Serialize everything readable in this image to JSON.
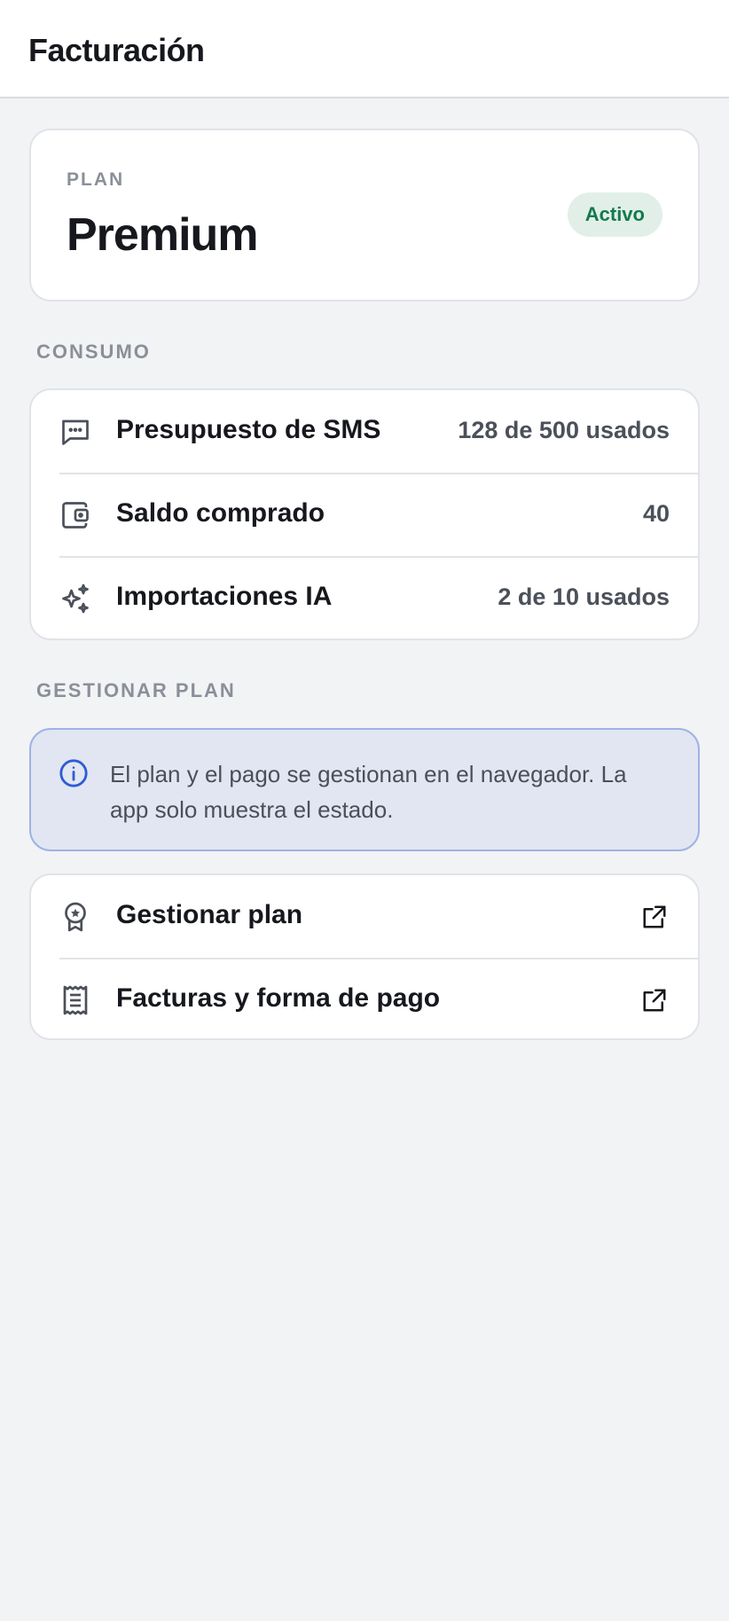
{
  "header": {
    "title": "Facturación"
  },
  "plan": {
    "label": "PLAN",
    "name": "Premium",
    "status": "Activo",
    "status_color": "#137a4e"
  },
  "consumo": {
    "title": "CONSUMO",
    "items": [
      {
        "icon": "message-dots-icon",
        "label": "Presupuesto de SMS",
        "value": "128 de 500 usados"
      },
      {
        "icon": "wallet-icon",
        "label": "Saldo comprado",
        "value": "40"
      },
      {
        "icon": "sparkles-icon",
        "label": "Importaciones IA",
        "value": "2 de 10 usados"
      }
    ]
  },
  "gestionar": {
    "title": "GESTIONAR PLAN",
    "info": "El plan y el pago se gestionan en el navegador. La app solo muestra el estado.",
    "links": [
      {
        "icon": "award-icon",
        "label": "Gestionar plan",
        "trailing_icon": "external-link-icon"
      },
      {
        "icon": "receipt-icon",
        "label": "Facturas y forma de pago",
        "trailing_icon": "external-link-icon"
      }
    ]
  },
  "colors": {
    "accent": "#2f5bd3",
    "background": "#f2f3f5",
    "info_bg": "#e1e6f2"
  }
}
